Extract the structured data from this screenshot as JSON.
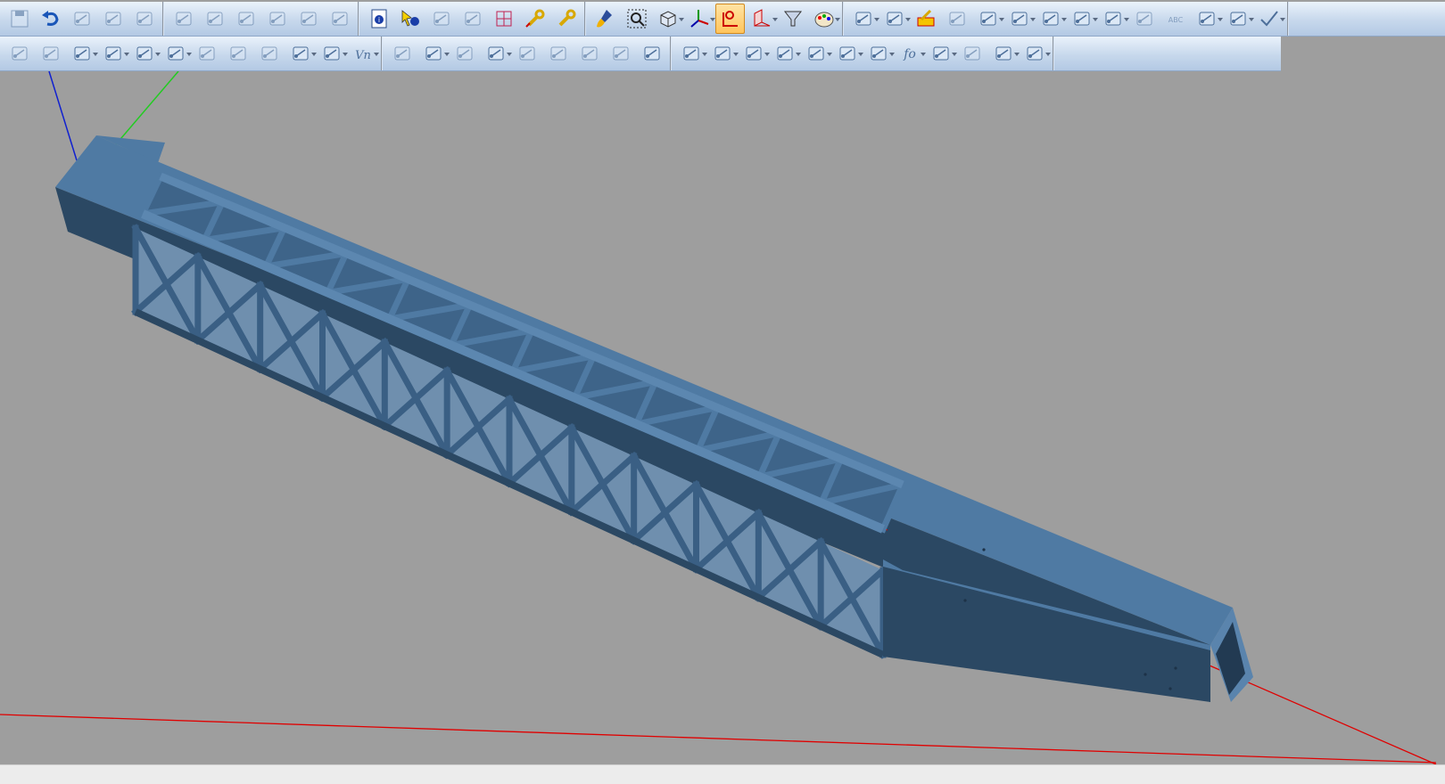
{
  "colors": {
    "background": "#9e9e9e",
    "toolbar": "#c7d8ec",
    "part_top": "#4f7aa3",
    "part_side": "#2b4863",
    "part_inner": "#3a5f84",
    "axis_x": "#e00000",
    "axis_y": "#22cc22",
    "axis_z": "#1020d0",
    "active": "#ffc55c"
  },
  "toolbar_row1": {
    "groups": [
      {
        "name": "file",
        "buttons": [
          {
            "icon": "save-icon",
            "state": "faded"
          },
          {
            "icon": "undo-icon",
            "state": "normal"
          },
          {
            "icon": "properties-icon",
            "state": "faded"
          },
          {
            "icon": "print-icon",
            "state": "faded"
          },
          {
            "icon": "measure-icon",
            "state": "faded"
          }
        ]
      },
      {
        "name": "sketch",
        "buttons": [
          {
            "icon": "sketch-edit-icon",
            "state": "faded"
          },
          {
            "icon": "sketch-copy-icon",
            "state": "faded"
          },
          {
            "icon": "sketch-mirror-icon",
            "state": "faded"
          },
          {
            "icon": "constraint-icon",
            "state": "faded"
          },
          {
            "icon": "dimension-icon",
            "state": "faded"
          },
          {
            "icon": "trim-icon",
            "state": "faded"
          }
        ]
      },
      {
        "name": "info",
        "buttons": [
          {
            "icon": "info-icon",
            "state": "normal"
          },
          {
            "icon": "pick-info-icon",
            "state": "normal"
          },
          {
            "icon": "query-icon",
            "state": "faded"
          },
          {
            "icon": "target-icon",
            "state": "faded"
          },
          {
            "icon": "grid-icon",
            "state": "normal"
          },
          {
            "icon": "wrench-edit-icon",
            "state": "normal"
          },
          {
            "icon": "wrench-icon",
            "state": "normal"
          }
        ]
      },
      {
        "name": "view",
        "buttons": [
          {
            "icon": "paint-brush-icon",
            "state": "normal"
          },
          {
            "icon": "zoom-fit-icon",
            "state": "normal"
          },
          {
            "icon": "view-cube-icon",
            "state": "dropdown"
          },
          {
            "icon": "axis-icon",
            "state": "dropdown"
          },
          {
            "icon": "shaded-mode-icon",
            "state": "active"
          },
          {
            "icon": "section-view-icon",
            "state": "dropdown"
          },
          {
            "icon": "filter-icon",
            "state": "normal"
          },
          {
            "icon": "color-palette-icon",
            "state": "dropdown"
          }
        ]
      },
      {
        "name": "geometry",
        "buttons": [
          {
            "icon": "hatch-icon",
            "state": "dropdown"
          },
          {
            "icon": "surface-icon",
            "state": "dropdown"
          },
          {
            "icon": "edit-part-icon",
            "state": "normal"
          },
          {
            "icon": "mirror-part-icon",
            "state": "faded"
          },
          {
            "icon": "line-icon",
            "state": "dropdown"
          },
          {
            "icon": "circle-icon",
            "state": "dropdown"
          },
          {
            "icon": "arc-icon",
            "state": "dropdown"
          },
          {
            "icon": "polygon-icon",
            "state": "dropdown"
          },
          {
            "icon": "ellipse-icon",
            "state": "dropdown"
          },
          {
            "icon": "spline-icon",
            "state": "faded"
          },
          {
            "icon": "text-icon",
            "state": "faded"
          },
          {
            "icon": "table-icon",
            "state": "dropdown"
          },
          {
            "icon": "point-icon",
            "state": "dropdown"
          },
          {
            "icon": "check-icon",
            "state": "dropdown"
          }
        ]
      }
    ]
  },
  "toolbar_row2": {
    "groups": [
      {
        "name": "modify",
        "buttons": [
          {
            "icon": "pen-icon",
            "state": "faded"
          },
          {
            "icon": "layers-icon",
            "state": "faded"
          },
          {
            "icon": "transform-icon",
            "state": "dropdown"
          },
          {
            "icon": "move-point-icon",
            "state": "dropdown"
          },
          {
            "icon": "line-edit-icon",
            "state": "dropdown"
          },
          {
            "icon": "extrude-icon",
            "state": "dropdown"
          },
          {
            "icon": "shell-icon",
            "state": "faded"
          },
          {
            "icon": "pattern-icon",
            "state": "faded"
          },
          {
            "icon": "array-icon",
            "state": "faded"
          },
          {
            "icon": "matrix-icon",
            "state": "dropdown"
          },
          {
            "icon": "cup-icon",
            "state": "dropdown"
          },
          {
            "icon": "variable-icon",
            "state": "dropdown"
          }
        ]
      },
      {
        "name": "analysis",
        "buttons": [
          {
            "icon": "query-tool-icon",
            "state": "faded"
          },
          {
            "icon": "document-icon",
            "state": "dropdown"
          },
          {
            "icon": "copy-doc-icon",
            "state": "faded"
          },
          {
            "icon": "scissor-icon",
            "state": "dropdown"
          },
          {
            "icon": "bend-1-icon",
            "state": "faded"
          },
          {
            "icon": "bend-2-icon",
            "state": "faded"
          },
          {
            "icon": "bend-3-icon",
            "state": "faded"
          },
          {
            "icon": "bend-4-icon",
            "state": "faded"
          },
          {
            "icon": "unfold-icon",
            "state": "normal"
          }
        ]
      },
      {
        "name": "assembly",
        "buttons": [
          {
            "icon": "assembly-icon",
            "state": "dropdown"
          },
          {
            "icon": "gear-link-icon",
            "state": "dropdown"
          },
          {
            "icon": "checklist-icon",
            "state": "dropdown"
          },
          {
            "icon": "clone-icon",
            "state": "dropdown"
          },
          {
            "icon": "beam-icon",
            "state": "dropdown"
          },
          {
            "icon": "spring-icon",
            "state": "dropdown"
          },
          {
            "icon": "barrier-icon",
            "state": "dropdown"
          },
          {
            "icon": "function-icon",
            "state": "dropdown"
          },
          {
            "icon": "light-icon",
            "state": "dropdown"
          },
          {
            "icon": "pencil-icon",
            "state": "faded"
          },
          {
            "icon": "ruler-icon",
            "state": "dropdown"
          },
          {
            "icon": "settings-icon",
            "state": "dropdown"
          }
        ]
      }
    ]
  },
  "model": {
    "name": "truss-tube",
    "bays": 12
  },
  "statusbar": {
    "text": ""
  }
}
